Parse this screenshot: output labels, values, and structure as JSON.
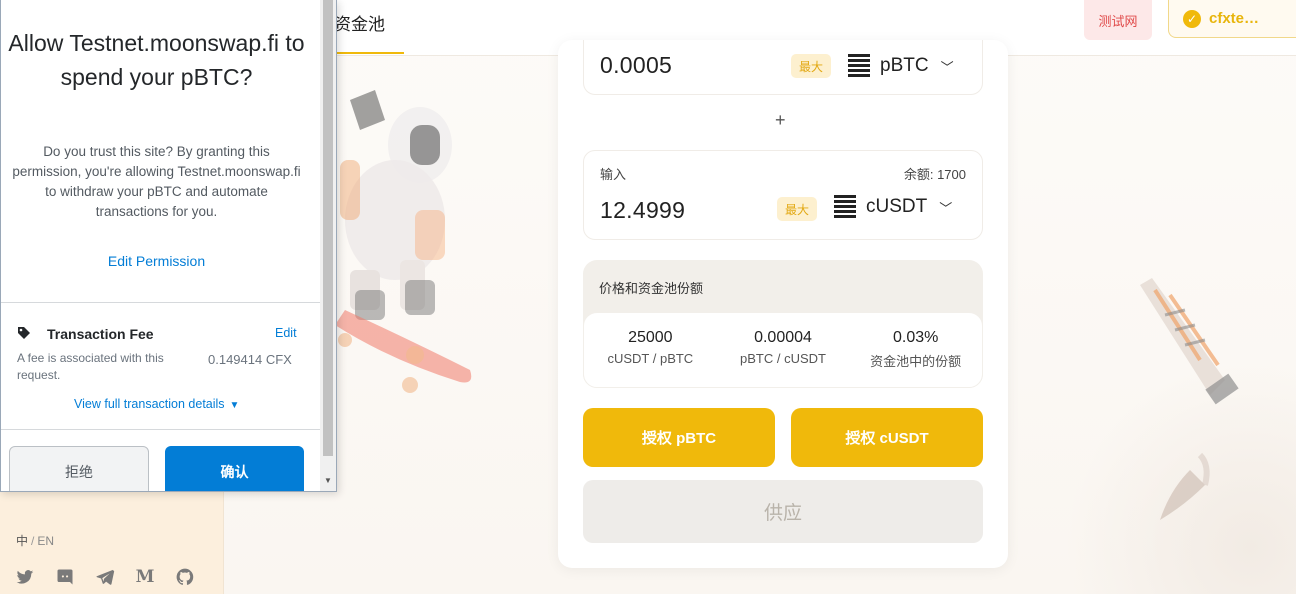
{
  "app": {
    "nav": {
      "pool_tab": "资金池"
    },
    "network_badge": "测试网",
    "wallet_address": "cfxte…",
    "footer": {
      "lang_zh": "中",
      "lang_sep": "/",
      "lang_en": "EN",
      "social_icons": [
        "twitter-icon",
        "discord-icon",
        "telegram-icon",
        "medium-icon",
        "github-icon"
      ]
    },
    "pool_card": {
      "token_a": {
        "amount": "0.0005",
        "max_label": "最大",
        "symbol": "pBTC"
      },
      "plus": "+",
      "token_b": {
        "label": "输入",
        "balance": "余额: 1700",
        "amount": "12.4999",
        "max_label": "最大",
        "symbol": "cUSDT"
      },
      "price_section": {
        "title": "价格和资金池份额",
        "stats": [
          {
            "value": "25000",
            "label": "cUSDT / pBTC"
          },
          {
            "value": "0.00004",
            "label": "pBTC / cUSDT"
          },
          {
            "value": "0.03%",
            "label": "资金池中的份额"
          }
        ]
      },
      "approve_a_label": "授权 pBTC",
      "approve_b_label": "授权 cUSDT",
      "supply_label": "供应"
    },
    "colors": {
      "accent": "#f0b90b",
      "wallet_blue": "#037dd6",
      "badge_red": "#e04a4a"
    }
  },
  "wallet_popup": {
    "title": "Allow Testnet.moonswap.fi to spend your pBTC?",
    "description": "Do you trust this site? By granting this permission, you're allowing Testnet.moonswap.fi to withdraw your pBTC and automate transactions for you.",
    "edit_permission": "Edit Permission",
    "fee": {
      "title": "Transaction Fee",
      "edit": "Edit",
      "note": "A fee is associated with this request.",
      "amount": "0.149414 CFX"
    },
    "view_details": "View full transaction details",
    "reject_label": "拒绝",
    "confirm_label": "确认"
  }
}
